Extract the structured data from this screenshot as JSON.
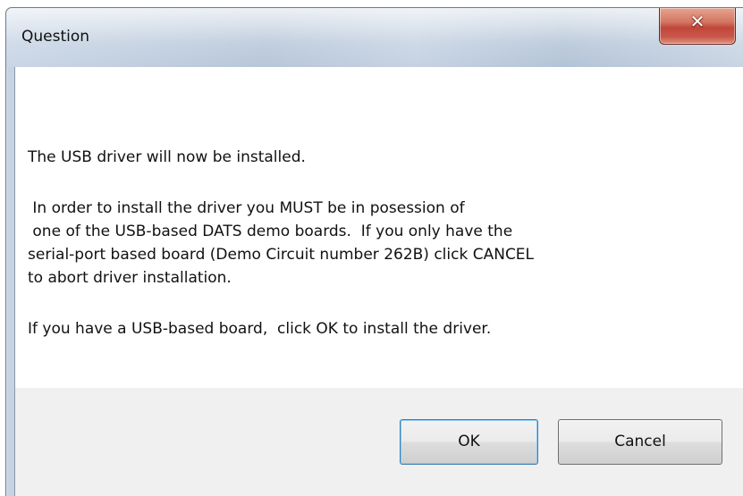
{
  "dialog": {
    "title": "Question",
    "close_icon": "✕",
    "message": {
      "line1": "The USB driver will now be installed.",
      "line2": " In order to install the driver you MUST be in posession of",
      "line3": " one of the USB-based DATS demo boards.  If you only have the",
      "line4": "serial-port based board (Demo Circuit number 262B) click CANCEL",
      "line5": "to abort driver installation.",
      "line6": "If you have a USB-based board,  click OK to install the driver."
    },
    "buttons": {
      "ok_label": "OK",
      "cancel_label": "Cancel"
    }
  }
}
